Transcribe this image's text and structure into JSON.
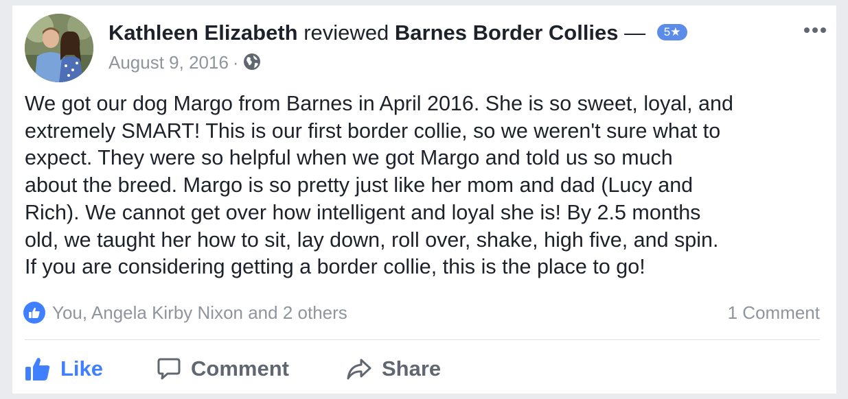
{
  "post": {
    "author": "Kathleen Elizabeth",
    "verb": "reviewed",
    "page_name": "Barnes Border Collies",
    "dash": "—",
    "rating": "5★",
    "date": "August 9, 2016",
    "separator": "·",
    "privacy_icon": "globe-icon",
    "more_icon": "more-options-icon"
  },
  "review": {
    "lines": [
      "We got our dog Margo from Barnes in April 2016. She is so sweet, loyal, and",
      "extremely SMART!  This is our first border collie, so we weren't sure what to",
      "expect. They were so helpful when we got Margo and told us so much",
      "about the breed. Margo is so pretty just like her mom and dad (Lucy and",
      "Rich). We cannot get over how intelligent and loyal she is! By 2.5 months",
      "old, we taught her how to sit, lay down, roll over, shake, high five, and spin.",
      "If you are considering getting a border collie, this is the place to go!"
    ]
  },
  "reactions": {
    "text": "You, Angela Kirby Nixon and 2 others",
    "icon": "like-reaction-icon"
  },
  "comments": {
    "count_text": "1 Comment"
  },
  "actions": {
    "like": "Like",
    "comment": "Comment",
    "share": "Share"
  },
  "colors": {
    "brand_blue": "#4080ff",
    "rating_badge": "#5b8de8",
    "secondary_text": "#90949c",
    "primary_text": "#1d2129",
    "action_text": "#606770"
  }
}
